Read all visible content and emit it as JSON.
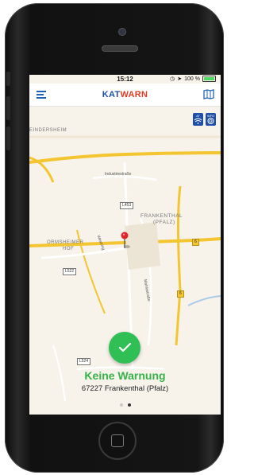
{
  "status_bar": {
    "time": "15:12",
    "battery_percent": "100 %",
    "battery_level": 1.0
  },
  "navbar": {
    "title_part1": "KAT",
    "title_part2": "WARN",
    "menu_icon": "hamburger-menu-icon",
    "map_icon": "map-book-icon"
  },
  "map": {
    "place_labels": {
      "eindersheim": "EINDERSHEIM",
      "frankenthal": "FRANKENTHAL",
      "pfalz": "(PFALZ)",
      "ormsheimer": "ORMSHEIMER",
      "hof": "HOF"
    },
    "street_labels": {
      "industriestrasse": "Industriestraße",
      "westring": "Westring",
      "mahlastrasse": "Mahlastraße"
    },
    "road_signs": {
      "l453": "L453",
      "l522": "L522",
      "l524": "L524",
      "a6a": "6",
      "a6b": "6"
    },
    "badges": {
      "wifi_label": "AT",
      "alert_label": "INFO"
    },
    "colors": {
      "background": "#f7f3ea",
      "highway": "#f3c531",
      "road": "#ffffff",
      "water": "#a9cbe7"
    }
  },
  "status": {
    "title": "Keine Warnung",
    "location": "67227 Frankenthal (Pfalz)",
    "color": "#2fbf55"
  },
  "pager": {
    "pages": 2,
    "active_index": 1
  }
}
